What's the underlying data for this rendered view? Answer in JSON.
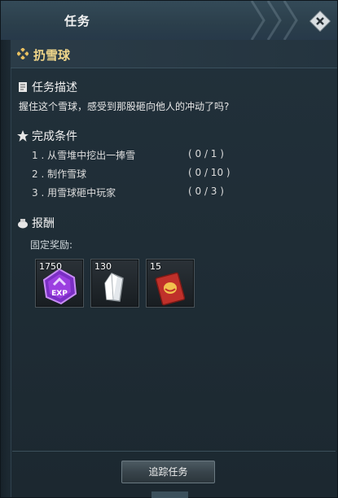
{
  "window": {
    "title": "任务"
  },
  "quest": {
    "name": "扔雪球"
  },
  "description": {
    "heading": "任务描述",
    "text": "握住这个雪球，感受到那股砸向他人的冲动了吗?"
  },
  "conditions": {
    "heading": "完成条件",
    "items": [
      {
        "label": "1 . 从雪堆中挖出一捧雪",
        "progress": "( 0 / 1 )"
      },
      {
        "label": "2 . 制作雪球",
        "progress": "( 0 / 10 )"
      },
      {
        "label": "3 . 用雪球砸中玩家",
        "progress": "( 0 / 3 )"
      }
    ]
  },
  "rewards": {
    "heading": "报酬",
    "fixed_label": "固定奖励:",
    "items": [
      {
        "count": "1750",
        "icon": "exp-icon",
        "icon_text": "EXP"
      },
      {
        "count": "130",
        "icon": "crystal-icon"
      },
      {
        "count": "15",
        "icon": "red-envelope-icon"
      }
    ]
  },
  "buttons": {
    "track": "追踪任务"
  },
  "colors": {
    "quest_name": "#f0d68a",
    "accent_purple": "#9b3fe0",
    "envelope_red": "#c0302a"
  }
}
